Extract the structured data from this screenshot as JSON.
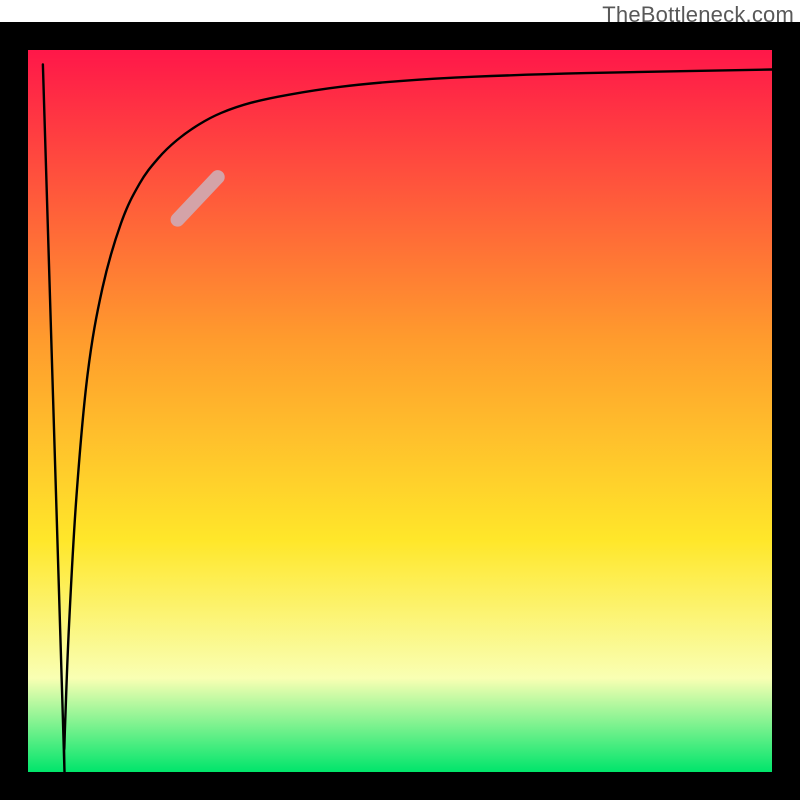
{
  "watermark": "TheBottleneck.com",
  "chart_data": {
    "type": "line",
    "title": "",
    "xlabel": "",
    "ylabel": "",
    "x_range": [
      0,
      100
    ],
    "y_range": [
      0,
      100
    ],
    "grid": false,
    "legend": false,
    "background_gradient": {
      "top": "#ff1749",
      "mid1": "#ff9b2d",
      "mid2": "#ffe72a",
      "mid3": "#f9ffb3",
      "bottom": "#00e56b"
    },
    "series": [
      {
        "name": "curve",
        "x": [
          2.0,
          4.7,
          4.85,
          5.0,
          5.5,
          6.5,
          8.0,
          10.0,
          12.5,
          15.0,
          17.5,
          20.0,
          23.0,
          26.0,
          30.0,
          35.0,
          42.0,
          50.0,
          60.0,
          75.0,
          100.0
        ],
        "y": [
          98.0,
          7.0,
          3.0,
          7.0,
          20.0,
          38.0,
          55.0,
          67.0,
          76.0,
          81.5,
          85.0,
          87.5,
          89.7,
          91.3,
          92.7,
          93.8,
          94.9,
          95.7,
          96.3,
          96.8,
          97.3
        ]
      }
    ],
    "highlight_segment": {
      "x_start": 20.1,
      "x_end": 25.5,
      "y_start": 76.5,
      "y_end": 82.4,
      "color": "#d4a3a8",
      "width": 14
    },
    "frame": {
      "color": "#000000",
      "width": 28
    }
  }
}
